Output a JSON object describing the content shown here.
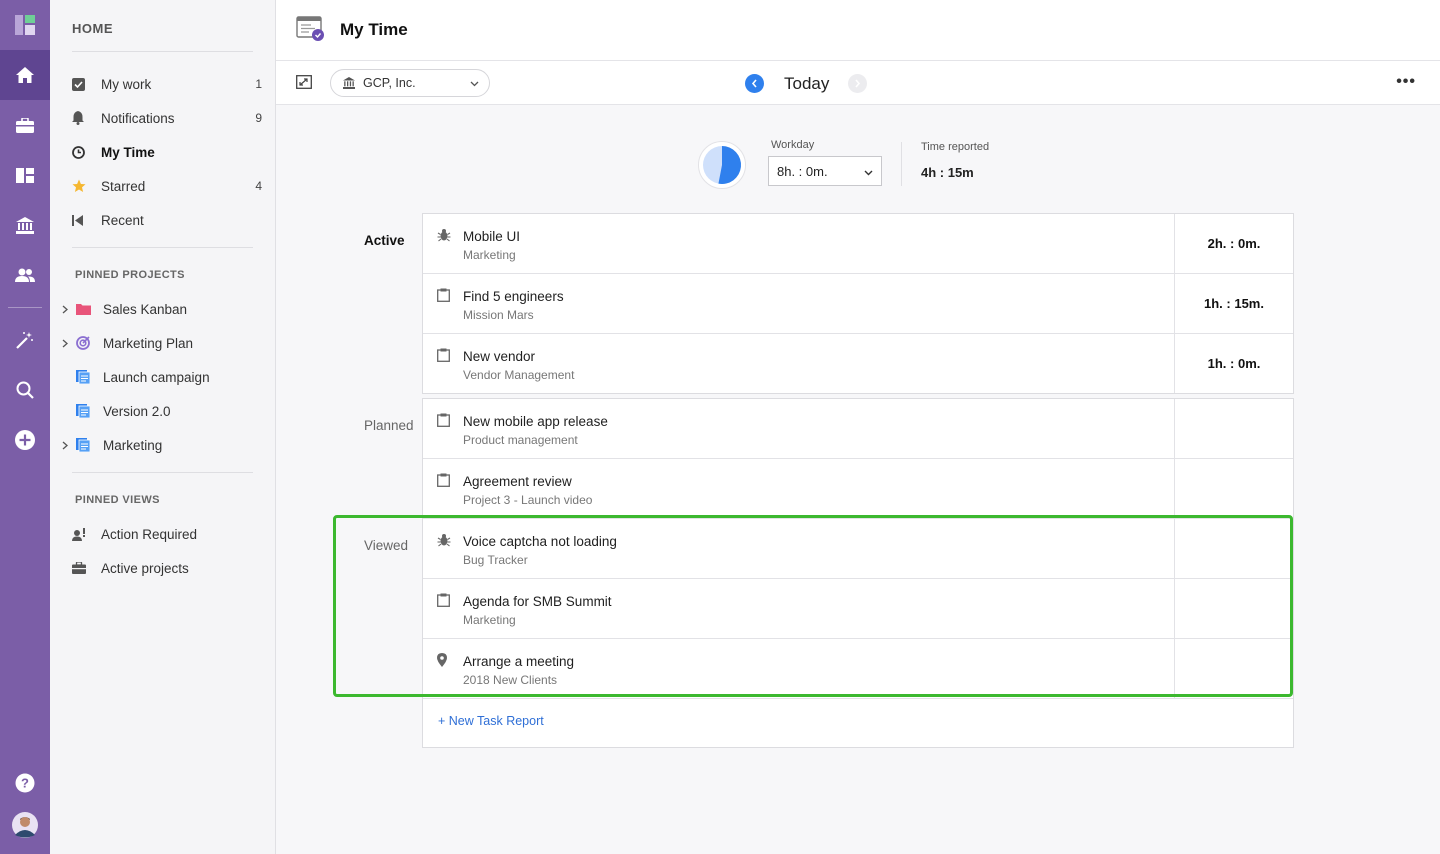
{
  "nav": {
    "home_label": "HOME",
    "items": [
      {
        "label": "My work",
        "count": "1"
      },
      {
        "label": "Notifications",
        "count": "9"
      },
      {
        "label": "My Time",
        "count": ""
      },
      {
        "label": "Starred",
        "count": "4"
      },
      {
        "label": "Recent",
        "count": ""
      }
    ],
    "pinned_projects_label": "PINNED PROJECTS",
    "pinned_projects": [
      {
        "label": "Sales Kanban"
      },
      {
        "label": "Marketing Plan"
      },
      {
        "label": "Launch campaign"
      },
      {
        "label": "Version 2.0"
      },
      {
        "label": "Marketing"
      }
    ],
    "pinned_views_label": "PINNED VIEWS",
    "pinned_views": [
      {
        "label": "Action Required"
      },
      {
        "label": "Active projects"
      }
    ]
  },
  "header": {
    "title": "My Time"
  },
  "toolbar": {
    "company": "GCP, Inc.",
    "date_label": "Today"
  },
  "summary": {
    "workday_label": "Workday",
    "workday_value": "8h. : 0m.",
    "reported_label": "Time reported",
    "reported_value": "4h : 15m",
    "reported_fraction": 0.53
  },
  "groups": {
    "active": {
      "label": "Active",
      "rows": [
        {
          "title": "Mobile UI",
          "sub": "Marketing",
          "time": "2h. : 0m.",
          "icon": "bug-icon"
        },
        {
          "title": "Find 5 engineers",
          "sub": "Mission Mars",
          "time": "1h. : 15m.",
          "icon": "clipboard-icon"
        },
        {
          "title": "New vendor",
          "sub": "Vendor Management",
          "time": "1h. : 0m.",
          "icon": "clipboard-icon"
        }
      ]
    },
    "planned": {
      "label": "Planned",
      "rows": [
        {
          "title": "New mobile app release",
          "sub": "Product management",
          "time": "",
          "icon": "clipboard-icon"
        },
        {
          "title": "Agreement review",
          "sub": "Project 3 - Launch video",
          "time": "",
          "icon": "clipboard-icon"
        }
      ]
    },
    "viewed": {
      "label": "Viewed",
      "rows": [
        {
          "title": "Voice captcha not loading",
          "sub": "Bug Tracker",
          "time": "",
          "icon": "bug-icon"
        },
        {
          "title": "Agenda for SMB Summit",
          "sub": "Marketing",
          "time": "",
          "icon": "clipboard-icon"
        },
        {
          "title": "Arrange a meeting",
          "sub": "2018 New Clients",
          "time": "",
          "icon": "pin-icon"
        }
      ]
    }
  },
  "new_task_label": "+ New Task Report",
  "colors": {
    "rail": "#7b5ea7",
    "accent": "#2f80ed",
    "highlight": "#3cb82f"
  }
}
